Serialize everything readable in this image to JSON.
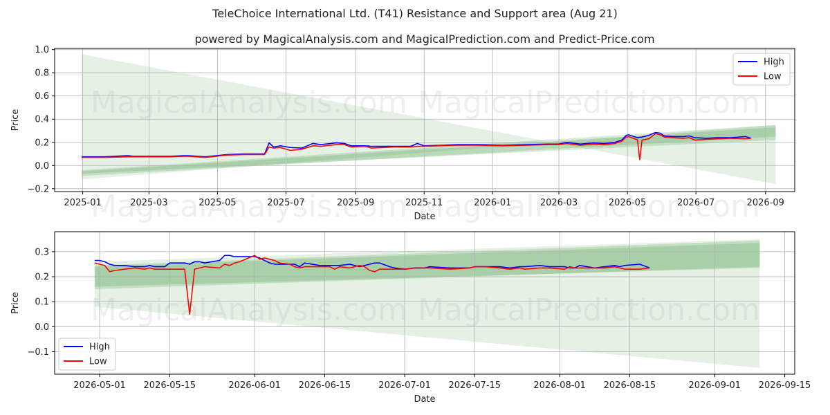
{
  "title": "TeleChoice International Ltd. (T41) Resistance and Support area (Aug 21)",
  "subtitle": "powered by MagicalAnalysis.com and MagicalPrediction.com and Predict-Price.com",
  "watermarks": [
    "MagicalAnalysis.com",
    "MagicalPrediction.com"
  ],
  "colors": {
    "high": "#0000ff",
    "low": "#ff0000",
    "band": "#2e8b2e",
    "grid": "#b0b0b0"
  },
  "chart_data": [
    {
      "type": "line",
      "xlabel": "Date",
      "ylabel": "Price",
      "xlim": [
        "2024-12-07",
        "2026-09-27"
      ],
      "ylim": [
        -0.225,
        1.01
      ],
      "grid": true,
      "legend_position": "top-right",
      "x_tick_labels": [
        "2025-01",
        "2025-03",
        "2025-05",
        "2025-07",
        "2025-09",
        "2025-11",
        "2026-01",
        "2026-03",
        "2026-05",
        "2026-07",
        "2026-09"
      ],
      "x_ticks": [
        "2025-01-01",
        "2025-03-01",
        "2025-05-01",
        "2025-07-01",
        "2025-09-01",
        "2025-11-01",
        "2026-01-01",
        "2026-03-01",
        "2026-05-01",
        "2026-07-01",
        "2026-09-01"
      ],
      "y_ticks": [
        -0.2,
        0.0,
        0.2,
        0.4,
        0.6,
        0.8,
        1.0
      ],
      "y_tick_labels": [
        "−0.2",
        "0.0",
        "0.2",
        "0.4",
        "0.6",
        "0.8",
        "1.0"
      ],
      "bands": [
        {
          "x_start": "2024-12-31",
          "x_end": "2026-09-10",
          "upper_start": 0.96,
          "upper_end": -0.16,
          "lower_start": -0.12,
          "lower_end": 0.35,
          "opacity": 0.12
        },
        {
          "x_start": "2024-12-31",
          "x_end": "2026-09-10",
          "upper_start": -0.04,
          "upper_end": 0.35,
          "lower_start": -0.09,
          "lower_end": 0.25,
          "opacity": 0.18
        },
        {
          "x_start": "2024-12-31",
          "x_end": "2026-09-10",
          "upper_start": -0.05,
          "upper_end": 0.33,
          "lower_start": -0.07,
          "lower_end": 0.22,
          "opacity": 0.18
        }
      ],
      "series": [
        {
          "name": "High",
          "x": [
            "2024-12-31",
            "2025-01-20",
            "2025-02-10",
            "2025-02-15",
            "2025-03-01",
            "2025-03-20",
            "2025-04-01",
            "2025-04-05",
            "2025-04-20",
            "2025-05-10",
            "2025-05-25",
            "2025-06-05",
            "2025-06-12",
            "2025-06-16",
            "2025-06-20",
            "2025-06-26",
            "2025-07-05",
            "2025-07-15",
            "2025-07-25",
            "2025-08-01",
            "2025-08-15",
            "2025-08-22",
            "2025-08-28",
            "2025-09-10",
            "2025-09-15",
            "2025-09-25",
            "2025-10-05",
            "2025-10-20",
            "2025-10-26",
            "2025-11-01",
            "2025-11-15",
            "2025-12-01",
            "2025-12-20",
            "2026-01-10",
            "2026-02-01",
            "2026-02-20",
            "2026-03-01",
            "2026-03-08",
            "2026-03-20",
            "2026-04-01",
            "2026-04-10",
            "2026-04-20",
            "2026-04-26",
            "2026-04-30",
            "2026-05-02",
            "2026-05-10",
            "2026-05-14",
            "2026-05-20",
            "2026-05-26",
            "2026-05-30",
            "2026-06-03",
            "2026-06-10",
            "2026-06-20",
            "2026-06-25",
            "2026-06-30",
            "2026-07-10",
            "2026-07-20",
            "2026-08-01",
            "2026-08-14",
            "2026-08-19"
          ],
          "y": [
            0.075,
            0.075,
            0.085,
            0.08,
            0.08,
            0.08,
            0.085,
            0.085,
            0.075,
            0.095,
            0.1,
            0.1,
            0.1,
            0.195,
            0.16,
            0.17,
            0.155,
            0.15,
            0.19,
            0.18,
            0.195,
            0.19,
            0.17,
            0.17,
            0.165,
            0.165,
            0.165,
            0.165,
            0.19,
            0.17,
            0.175,
            0.18,
            0.18,
            0.175,
            0.18,
            0.185,
            0.185,
            0.2,
            0.185,
            0.195,
            0.19,
            0.2,
            0.22,
            0.26,
            0.265,
            0.24,
            0.245,
            0.26,
            0.285,
            0.28,
            0.255,
            0.25,
            0.25,
            0.255,
            0.24,
            0.235,
            0.24,
            0.24,
            0.25,
            0.235
          ]
        },
        {
          "name": "Low",
          "x": [
            "2024-12-31",
            "2025-01-20",
            "2025-02-10",
            "2025-02-15",
            "2025-03-01",
            "2025-03-20",
            "2025-04-01",
            "2025-04-05",
            "2025-04-20",
            "2025-05-10",
            "2025-05-25",
            "2025-06-05",
            "2025-06-12",
            "2025-06-16",
            "2025-06-20",
            "2025-06-26",
            "2025-07-05",
            "2025-07-15",
            "2025-07-25",
            "2025-08-01",
            "2025-08-15",
            "2025-08-22",
            "2025-08-28",
            "2025-09-10",
            "2025-09-15",
            "2025-09-25",
            "2025-10-05",
            "2025-10-20",
            "2025-10-26",
            "2025-11-01",
            "2025-11-15",
            "2025-12-01",
            "2025-12-20",
            "2026-01-10",
            "2026-02-01",
            "2026-02-20",
            "2026-03-01",
            "2026-03-08",
            "2026-03-20",
            "2026-04-01",
            "2026-04-10",
            "2026-04-20",
            "2026-04-26",
            "2026-04-30",
            "2026-05-02",
            "2026-05-10",
            "2026-05-12",
            "2026-05-14",
            "2026-05-20",
            "2026-05-26",
            "2026-05-30",
            "2026-06-03",
            "2026-06-10",
            "2026-06-20",
            "2026-06-25",
            "2026-06-30",
            "2026-07-10",
            "2026-07-20",
            "2026-08-01",
            "2026-08-14",
            "2026-08-19"
          ],
          "y": [
            0.07,
            0.07,
            0.075,
            0.075,
            0.075,
            0.075,
            0.08,
            0.08,
            0.07,
            0.09,
            0.095,
            0.095,
            0.095,
            0.16,
            0.15,
            0.155,
            0.13,
            0.14,
            0.17,
            0.165,
            0.18,
            0.18,
            0.16,
            0.165,
            0.15,
            0.155,
            0.16,
            0.16,
            0.165,
            0.165,
            0.17,
            0.175,
            0.175,
            0.17,
            0.175,
            0.18,
            0.18,
            0.19,
            0.175,
            0.185,
            0.18,
            0.19,
            0.21,
            0.245,
            0.25,
            0.22,
            0.05,
            0.22,
            0.23,
            0.275,
            0.265,
            0.245,
            0.24,
            0.235,
            0.24,
            0.22,
            0.225,
            0.23,
            0.235,
            0.23,
            0.235
          ]
        }
      ]
    },
    {
      "type": "line",
      "xlabel": "Date",
      "ylabel": "Price",
      "xlim": [
        "2026-04-22",
        "2026-09-17"
      ],
      "ylim": [
        -0.19,
        0.38
      ],
      "grid": true,
      "legend_position": "bottom-left",
      "x_tick_labels": [
        "2026-05-01",
        "2026-05-15",
        "2026-06-01",
        "2026-06-15",
        "2026-07-01",
        "2026-07-15",
        "2026-08-01",
        "2026-08-15",
        "2026-09-01",
        "2026-09-15"
      ],
      "x_ticks": [
        "2026-05-01",
        "2026-05-15",
        "2026-06-01",
        "2026-06-15",
        "2026-07-01",
        "2026-07-15",
        "2026-08-01",
        "2026-08-15",
        "2026-09-01",
        "2026-09-15"
      ],
      "y_ticks": [
        -0.1,
        0.0,
        0.1,
        0.2,
        0.3
      ],
      "y_tick_labels": [
        "−0.1",
        "0.0",
        "0.1",
        "0.2",
        "0.3"
      ],
      "bands": [
        {
          "x_start": "2026-04-30",
          "x_end": "2026-09-10",
          "upper_start": 0.26,
          "upper_end": 0.35,
          "lower_start": 0.08,
          "lower_end": -0.165,
          "opacity": 0.12
        },
        {
          "x_start": "2026-04-30",
          "x_end": "2026-09-10",
          "upper_start": 0.245,
          "upper_end": 0.345,
          "lower_start": 0.15,
          "lower_end": 0.24,
          "opacity": 0.18
        },
        {
          "x_start": "2026-04-30",
          "x_end": "2026-09-10",
          "upper_start": 0.24,
          "upper_end": 0.335,
          "lower_start": 0.16,
          "lower_end": 0.235,
          "opacity": 0.18
        }
      ],
      "series": [
        {
          "name": "High",
          "x": [
            "2026-04-30",
            "2026-05-01",
            "2026-05-02",
            "2026-05-03",
            "2026-05-04",
            "2026-05-06",
            "2026-05-08",
            "2026-05-10",
            "2026-05-11",
            "2026-05-12",
            "2026-05-13",
            "2026-05-14",
            "2026-05-15",
            "2026-05-18",
            "2026-05-19",
            "2026-05-20",
            "2026-05-21",
            "2026-05-22",
            "2026-05-25",
            "2026-05-26",
            "2026-05-27",
            "2026-05-28",
            "2026-05-29",
            "2026-06-01",
            "2026-06-02",
            "2026-06-03",
            "2026-06-04",
            "2026-06-05",
            "2026-06-06",
            "2026-06-08",
            "2026-06-09",
            "2026-06-10",
            "2026-06-11",
            "2026-06-14",
            "2026-06-15",
            "2026-06-16",
            "2026-06-17",
            "2026-06-18",
            "2026-06-20",
            "2026-06-22",
            "2026-06-23",
            "2026-06-24",
            "2026-06-25",
            "2026-06-26",
            "2026-06-28",
            "2026-06-29",
            "2026-07-01",
            "2026-07-03",
            "2026-07-05",
            "2026-07-06",
            "2026-07-10",
            "2026-07-14",
            "2026-07-15",
            "2026-07-17",
            "2026-07-20",
            "2026-07-22",
            "2026-07-24",
            "2026-07-25",
            "2026-07-28",
            "2026-07-30",
            "2026-08-02",
            "2026-08-03",
            "2026-08-04",
            "2026-08-05",
            "2026-08-08",
            "2026-08-10",
            "2026-08-12",
            "2026-08-13",
            "2026-08-14",
            "2026-08-17",
            "2026-08-19"
          ],
          "y": [
            0.265,
            0.265,
            0.26,
            0.25,
            0.245,
            0.245,
            0.24,
            0.24,
            0.245,
            0.24,
            0.24,
            0.24,
            0.255,
            0.255,
            0.25,
            0.26,
            0.26,
            0.255,
            0.265,
            0.285,
            0.285,
            0.28,
            0.28,
            0.28,
            0.275,
            0.265,
            0.255,
            0.25,
            0.25,
            0.25,
            0.25,
            0.24,
            0.255,
            0.245,
            0.245,
            0.245,
            0.245,
            0.245,
            0.25,
            0.24,
            0.245,
            0.25,
            0.255,
            0.255,
            0.24,
            0.235,
            0.23,
            0.235,
            0.235,
            0.24,
            0.235,
            0.235,
            0.24,
            0.24,
            0.24,
            0.235,
            0.24,
            0.24,
            0.245,
            0.24,
            0.24,
            0.235,
            0.235,
            0.245,
            0.235,
            0.24,
            0.245,
            0.24,
            0.245,
            0.25,
            0.235
          ]
        },
        {
          "name": "Low",
          "x": [
            "2026-04-30",
            "2026-05-01",
            "2026-05-02",
            "2026-05-03",
            "2026-05-04",
            "2026-05-06",
            "2026-05-08",
            "2026-05-10",
            "2026-05-11",
            "2026-05-12",
            "2026-05-13",
            "2026-05-14",
            "2026-05-15",
            "2026-05-18",
            "2026-05-19",
            "2026-05-20",
            "2026-05-21",
            "2026-05-22",
            "2026-05-25",
            "2026-05-26",
            "2026-05-27",
            "2026-05-28",
            "2026-05-29",
            "2026-06-01",
            "2026-06-02",
            "2026-06-03",
            "2026-06-04",
            "2026-06-05",
            "2026-06-06",
            "2026-06-08",
            "2026-06-09",
            "2026-06-10",
            "2026-06-11",
            "2026-06-14",
            "2026-06-15",
            "2026-06-16",
            "2026-06-17",
            "2026-06-18",
            "2026-06-20",
            "2026-06-22",
            "2026-06-23",
            "2026-06-24",
            "2026-06-25",
            "2026-06-26",
            "2026-06-28",
            "2026-06-29",
            "2026-07-01",
            "2026-07-03",
            "2026-07-05",
            "2026-07-06",
            "2026-07-10",
            "2026-07-14",
            "2026-07-15",
            "2026-07-17",
            "2026-07-20",
            "2026-07-22",
            "2026-07-24",
            "2026-07-25",
            "2026-07-28",
            "2026-07-30",
            "2026-08-02",
            "2026-08-03",
            "2026-08-04",
            "2026-08-05",
            "2026-08-08",
            "2026-08-10",
            "2026-08-12",
            "2026-08-13",
            "2026-08-14",
            "2026-08-17",
            "2026-08-19"
          ],
          "y": [
            0.255,
            0.25,
            0.245,
            0.22,
            0.225,
            0.23,
            0.235,
            0.23,
            0.235,
            0.23,
            0.23,
            0.23,
            0.23,
            0.23,
            0.05,
            0.23,
            0.235,
            0.24,
            0.235,
            0.25,
            0.245,
            0.255,
            0.26,
            0.285,
            0.27,
            0.275,
            0.27,
            0.265,
            0.255,
            0.25,
            0.24,
            0.235,
            0.24,
            0.24,
            0.24,
            0.24,
            0.23,
            0.24,
            0.235,
            0.245,
            0.24,
            0.225,
            0.22,
            0.23,
            0.23,
            0.23,
            0.23,
            0.235,
            0.235,
            0.235,
            0.23,
            0.235,
            0.24,
            0.24,
            0.235,
            0.23,
            0.235,
            0.23,
            0.235,
            0.235,
            0.23,
            0.24,
            0.235,
            0.235,
            0.235,
            0.235,
            0.24,
            0.235,
            0.23,
            0.23,
            0.235
          ]
        }
      ]
    }
  ]
}
